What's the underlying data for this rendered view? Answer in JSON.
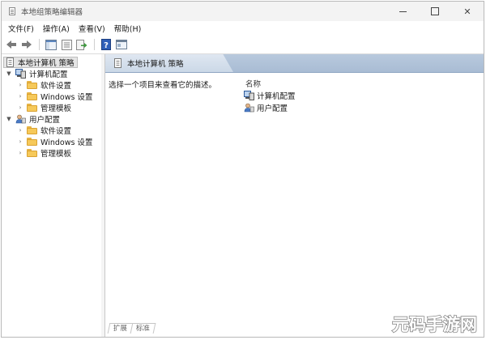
{
  "window": {
    "title": "本地组策略编辑器",
    "controls": {
      "minimize": "minimize",
      "maximize": "maximize",
      "close": "✕"
    }
  },
  "menu": [
    "文件(F)",
    "操作(A)",
    "查看(V)",
    "帮助(H)"
  ],
  "toolbar": [
    "back-icon",
    "forward-icon",
    "show-hide-tree-icon",
    "properties-icon",
    "export-list-icon",
    "help-icon",
    "console-icon"
  ],
  "tree": {
    "root": "本地计算机 策略",
    "computer": {
      "label": "计算机配置",
      "children": [
        "软件设置",
        "Windows 设置",
        "管理模板"
      ]
    },
    "user": {
      "label": "用户配置",
      "children": [
        "软件设置",
        "Windows 设置",
        "管理模板"
      ]
    }
  },
  "detail": {
    "header": "本地计算机 策略",
    "description": "选择一个项目来查看它的描述。",
    "column_name": "名称",
    "items": [
      "计算机配置",
      "用户配置"
    ]
  },
  "bottom_tabs": [
    "扩展",
    "标准"
  ],
  "watermark": "元码手游网",
  "colors": {
    "header_band": "#b8c9dd",
    "folder": "#f6c95a",
    "titlebar": "#f3f3f3"
  }
}
